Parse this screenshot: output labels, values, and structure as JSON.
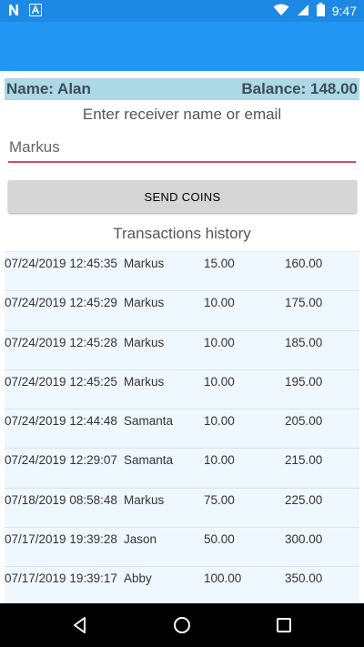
{
  "status_bar": {
    "time": "9:47",
    "icons": [
      "n-notification-icon",
      "a-notification-icon",
      "wifi-icon",
      "signal-icon",
      "battery-icon"
    ]
  },
  "user": {
    "name": "Name: Alan",
    "balance": "Balance: 148.00"
  },
  "receiver": {
    "label": "Enter receiver name or email",
    "value": "Markus"
  },
  "send_button_label": "SEND COINS",
  "history": {
    "title": "Transactions history",
    "rows": [
      {
        "date": "07/24/2019 12:45:35",
        "name": "Markus",
        "amount": "15.00",
        "balance": "160.00"
      },
      {
        "date": "07/24/2019 12:45:29",
        "name": "Markus",
        "amount": "10.00",
        "balance": "175.00"
      },
      {
        "date": "07/24/2019 12:45:28",
        "name": "Markus",
        "amount": "10.00",
        "balance": "185.00"
      },
      {
        "date": "07/24/2019 12:45:25",
        "name": "Markus",
        "amount": "10.00",
        "balance": "195.00"
      },
      {
        "date": "07/24/2019 12:44:48",
        "name": "Samanta",
        "amount": "10.00",
        "balance": "205.00"
      },
      {
        "date": "07/24/2019 12:29:07",
        "name": "Samanta",
        "amount": "10.00",
        "balance": "215.00"
      },
      {
        "date": "07/18/2019 08:58:48",
        "name": "Markus",
        "amount": "75.00",
        "balance": "225.00"
      },
      {
        "date": "07/17/2019 19:39:28",
        "name": "Jason",
        "amount": "50.00",
        "balance": "300.00"
      },
      {
        "date": "07/17/2019 19:39:17",
        "name": "Abby",
        "amount": "100.00",
        "balance": "350.00"
      }
    ]
  },
  "colors": {
    "status_bar": "#1e88e5",
    "app_bar": "#2196f3",
    "user_strip": "#add8e6",
    "input_underline": "#d5487a",
    "list_background": "#f0f8ff"
  }
}
